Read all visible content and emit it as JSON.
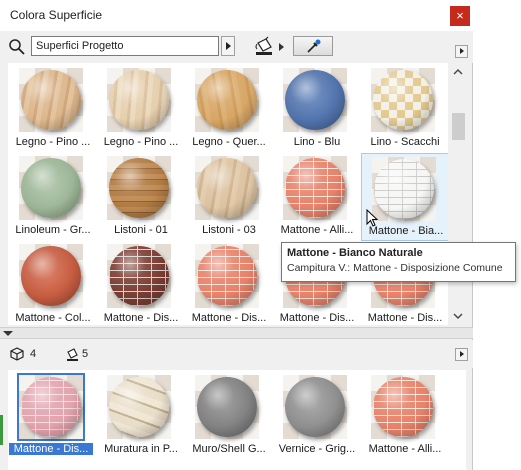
{
  "window": {
    "title": "Colora Superficie"
  },
  "toolbar": {
    "search_value": "Superfici Progetto"
  },
  "grid_items": [
    {
      "label": "Legno - Pino ...",
      "style": "wood-light"
    },
    {
      "label": "Legno - Pino ...",
      "style": "wood-pale"
    },
    {
      "label": "Legno - Quer...",
      "style": "wood-oak"
    },
    {
      "label": "Lino - Blu",
      "style": "blue"
    },
    {
      "label": "Lino - Scacchi",
      "style": "checker"
    },
    {
      "label": "Linoleum - Gr...",
      "style": "green"
    },
    {
      "label": "Listoni - 01",
      "style": "planks"
    },
    {
      "label": "Listoni - 03",
      "style": "wood-beige"
    },
    {
      "label": "Mattone - Alli...",
      "style": "brick-red"
    },
    {
      "label": "Mattone - Bia...",
      "style": "brick-white"
    },
    {
      "label": "Mattone - Col...",
      "style": "terracotta"
    },
    {
      "label": "Mattone - Dis...",
      "style": "brick-dark"
    },
    {
      "label": "Mattone - Dis...",
      "style": "brick-red"
    },
    {
      "label": "Mattone - Dis...",
      "style": "brick-red"
    },
    {
      "label": "Mattone - Dis...",
      "style": "brick-red"
    }
  ],
  "tooltip": {
    "title": "Mattone - Bianco Naturale",
    "subtitle": "Campitura V.: Mattone - Disposizione Comune"
  },
  "status": {
    "model_count": "4",
    "paint_count": "5"
  },
  "bottom_items": [
    {
      "label": "Mattone - Dis...",
      "style": "brick-pink",
      "selected": true
    },
    {
      "label": "Muratura in P...",
      "style": "stone",
      "selected": false
    },
    {
      "label": "Muro/Shell G...",
      "style": "gray",
      "selected": false
    },
    {
      "label": "Vernice - Grig...",
      "style": "gray-light",
      "selected": false
    },
    {
      "label": "Mattone - Alli...",
      "style": "brick-red",
      "selected": false
    }
  ],
  "colors": {
    "close_button": "#c42b1c",
    "selection": "#3b78d4",
    "hover_background": "#e5f1fb"
  }
}
